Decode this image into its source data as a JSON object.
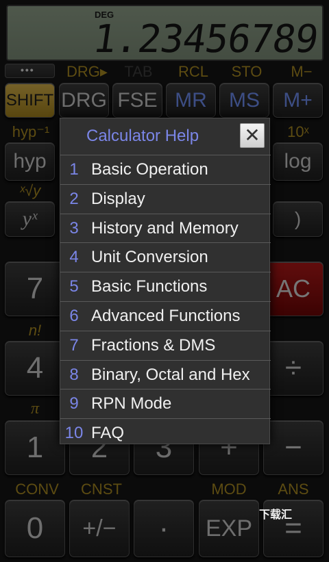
{
  "display": {
    "angle_mode": "DEG",
    "value": "1.23456789"
  },
  "top_row": {
    "dots": "•••"
  },
  "secondary_labels": {
    "drg_shift": "DRG▸",
    "tab": "TAB",
    "rcl": "RCL",
    "sto": "STO",
    "m_minus": "M−",
    "hyp_inv": "hyp⁻¹",
    "ten_x": "10ˣ",
    "x_root_y": "ˣ√y",
    "factorial": "n!",
    "pi": "π",
    "conv": "CONV",
    "cnst": "CNST",
    "mod": "MOD",
    "ans": "ANS"
  },
  "keys": {
    "shift": "SHIFT",
    "drg": "DRG",
    "fse": "FSE",
    "mr": "MR",
    "ms": "MS",
    "m_plus": "M+",
    "hyp": "hyp",
    "log": "log",
    "y_x": "yˣ",
    "rparen": ")",
    "seven": "7",
    "ac": "AC",
    "four": "4",
    "divide": "÷",
    "one": "1",
    "two": "2",
    "three": "3",
    "plus": "+",
    "minus": "−",
    "zero": "0",
    "plus_minus": "+/−",
    "dot": "·",
    "exp": "EXP",
    "equals": "="
  },
  "help_dialog": {
    "title": "Calculator Help",
    "close": "✕",
    "items": [
      {
        "num": "1",
        "label": "Basic Operation"
      },
      {
        "num": "2",
        "label": "Display"
      },
      {
        "num": "3",
        "label": "History and Memory"
      },
      {
        "num": "4",
        "label": "Unit Conversion"
      },
      {
        "num": "5",
        "label": "Basic Functions"
      },
      {
        "num": "6",
        "label": "Advanced Functions"
      },
      {
        "num": "7",
        "label": "Fractions & DMS"
      },
      {
        "num": "8",
        "label": "Binary, Octal and Hex"
      },
      {
        "num": "9",
        "label": "RPN Mode"
      },
      {
        "num": "10",
        "label": "FAQ"
      }
    ]
  },
  "watermark": "下载汇",
  "colors": {
    "accent_gold": "#a98a22",
    "accent_blue": "#7b86e8",
    "ac_red": "#b11818"
  }
}
